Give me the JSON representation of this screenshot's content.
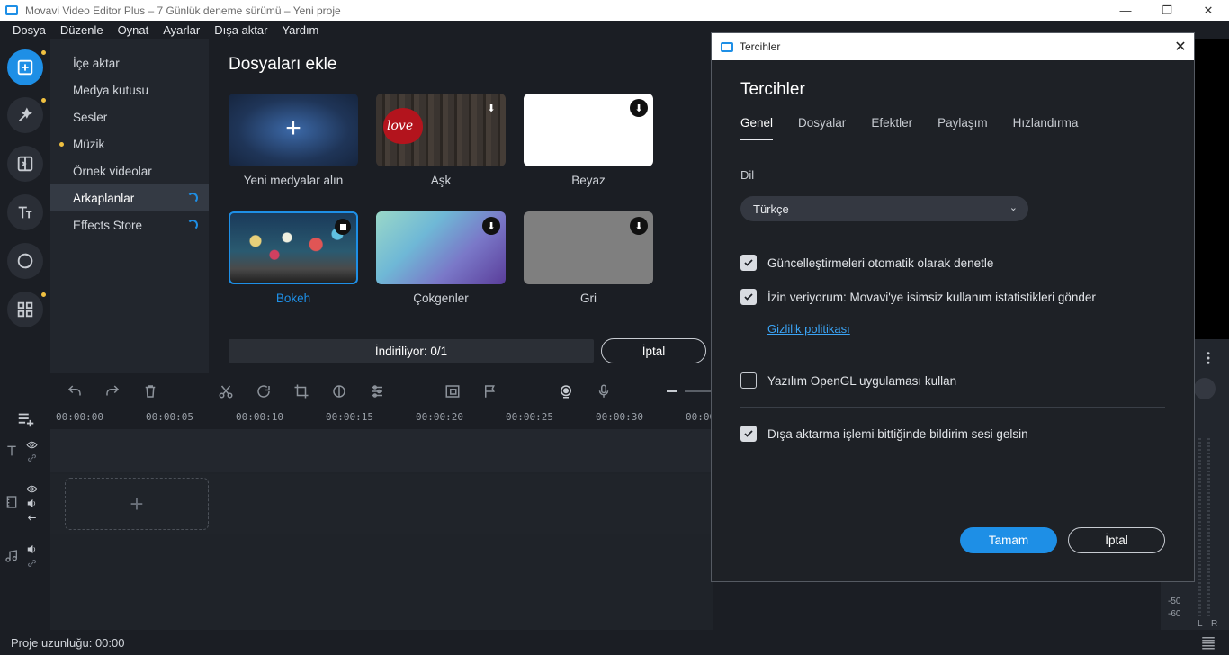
{
  "window": {
    "title": "Movavi Video Editor Plus – 7 Günlük deneme sürümü – Yeni proje",
    "minimize": "—",
    "restore": "❐",
    "close": "✕"
  },
  "menu": [
    "Dosya",
    "Düzenle",
    "Oynat",
    "Ayarlar",
    "Dışa aktar",
    "Yardım"
  ],
  "tools": [
    {
      "name": "import-icon"
    },
    {
      "name": "magic-wand-icon"
    },
    {
      "name": "transitions-icon"
    },
    {
      "name": "titles-icon"
    },
    {
      "name": "filters-icon"
    },
    {
      "name": "more-tools-icon"
    }
  ],
  "categories": [
    "İçe aktar",
    "Medya kutusu",
    "Sesler",
    "Müzik",
    "Örnek videolar",
    "Arkaplanlar",
    "Effects Store"
  ],
  "content": {
    "heading": "Dosyaları ekle",
    "tiles": [
      {
        "label": "Yeni medyalar alın"
      },
      {
        "label": "Aşk"
      },
      {
        "label": "Beyaz"
      },
      {
        "label": "Bokeh"
      },
      {
        "label": "Çokgenler"
      },
      {
        "label": "Gri"
      }
    ],
    "love_text": "love",
    "plus": "+",
    "download_glyph": "⬇",
    "progress_label": "İndiriliyor: 0/1",
    "cancel_label": "İptal"
  },
  "timeline": {
    "ruler": [
      "00:00:00",
      "00:00:05",
      "00:00:10",
      "00:00:15",
      "00:00:20",
      "00:00:25",
      "00:00:30",
      "00:00"
    ],
    "drop_plus": "+"
  },
  "meter": {
    "db_labels": [
      "-50",
      "-60"
    ],
    "channels": [
      "L",
      "R"
    ]
  },
  "status": {
    "project_length": "Proje uzunluğu: 00:00"
  },
  "dialog": {
    "window_title": "Tercihler",
    "close": "✕",
    "heading": "Tercihler",
    "tabs": [
      "Genel",
      "Dosyalar",
      "Efektler",
      "Paylaşım",
      "Hızlandırma"
    ],
    "language_label": "Dil",
    "language_value": "Türkçe",
    "chevron": "⌄",
    "options": [
      {
        "label": "Güncelleştirmeleri otomatik olarak denetle",
        "checked": true
      },
      {
        "label": "İzin veriyorum: Movavi'ye isimsiz kullanım istatistikleri gönder",
        "checked": true
      },
      {
        "label": "Yazılım OpenGL uygulaması kullan",
        "checked": false
      },
      {
        "label": "Dışa aktarma işlemi bittiğinde bildirim sesi gelsin",
        "checked": true
      }
    ],
    "privacy_link": "Gizlilik politikası",
    "ok": "Tamam",
    "cancel": "İptal"
  },
  "colors": {
    "accent": "#1e8fe6",
    "background": "#1b1e24",
    "panel": "#22262d",
    "dialog": "#1e2126"
  }
}
